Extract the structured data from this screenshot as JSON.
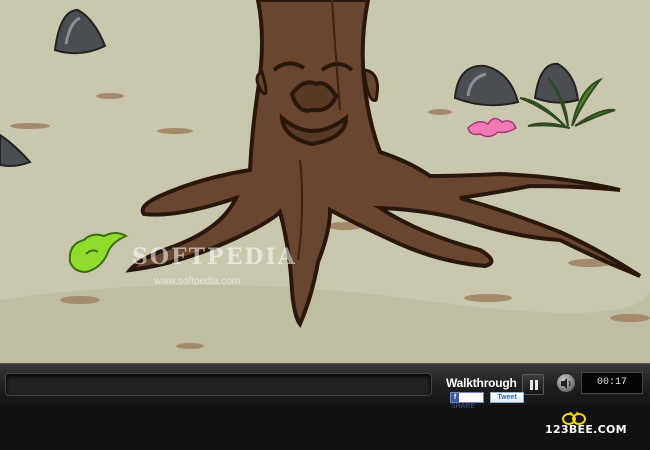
{
  "scene": {
    "name": "forest clearing with tree face",
    "watermark": "SOFTPEDIA",
    "watermark_url": "www.softpedia.com",
    "colors": {
      "ground": "#c9c8ae",
      "trunk": "#6a4630",
      "trunk_dark": "#3b2414",
      "rock": "#4a4d52",
      "leaf_green": "#8fdc2c",
      "flower_pink": "#f07ab3"
    },
    "items": [
      "tree-face",
      "green-leaf-creature",
      "pink-flower",
      "rock-left",
      "rock-right",
      "rock-top",
      "fern"
    ]
  },
  "controls": {
    "walkthrough_label": "Walkthrough",
    "pause_icon": "pause-icon",
    "sound_icon": "speaker-icon",
    "timer": "00:17",
    "share_label": "SHARE",
    "tweet_label": "Tweet"
  },
  "brand": {
    "logo": "123BEE.COM",
    "logo_icon": "bee-icon"
  }
}
